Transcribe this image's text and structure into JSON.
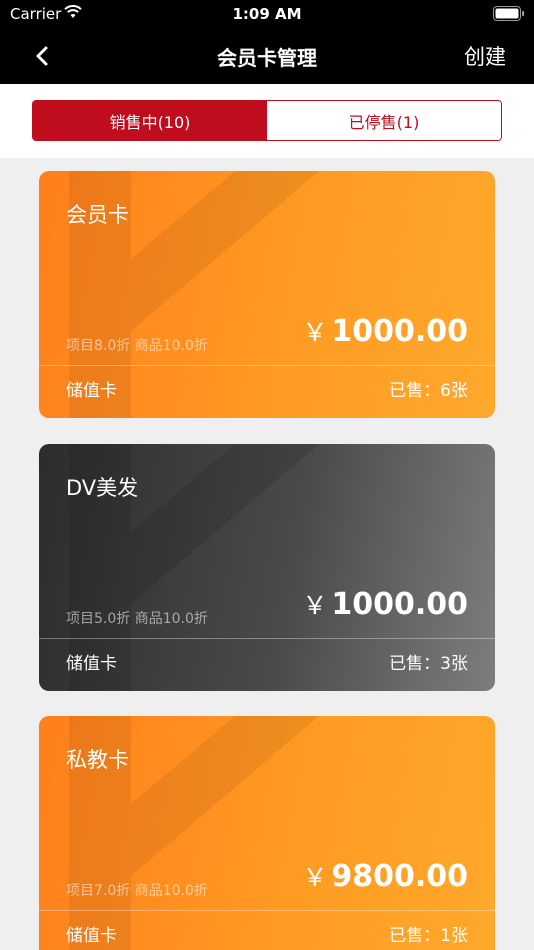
{
  "status_bar": {
    "carrier": "Carrier",
    "time": "1:09 AM"
  },
  "nav": {
    "title": "会员卡管理",
    "create_label": "创建",
    "back_icon": "chevron-left-icon"
  },
  "tabs": [
    {
      "label": "销售中(10)",
      "active": true
    },
    {
      "label": "已停售(1)",
      "active": false
    }
  ],
  "cards": [
    {
      "name": "会员卡",
      "discount": "项目8.0折 商品10.0折",
      "currency": "￥",
      "price": "1000.00",
      "type": "储值卡",
      "sold": "已售：6张",
      "theme": "orange"
    },
    {
      "name": "DV美发",
      "discount": "项目5.0折 商品10.0折",
      "currency": "￥",
      "price": "1000.00",
      "type": "储值卡",
      "sold": "已售：3张",
      "theme": "dark"
    },
    {
      "name": "私教卡",
      "discount": "项目7.0折 商品10.0折",
      "currency": "￥",
      "price": "9800.00",
      "type": "储值卡",
      "sold": "已售：1张",
      "theme": "orange"
    }
  ],
  "colors": {
    "accent": "#c00d1e",
    "orange_start": "#ff7f1c",
    "orange_end": "#ffa92c",
    "dark_start": "#2c2c2c",
    "dark_end": "#7d7d7d"
  }
}
